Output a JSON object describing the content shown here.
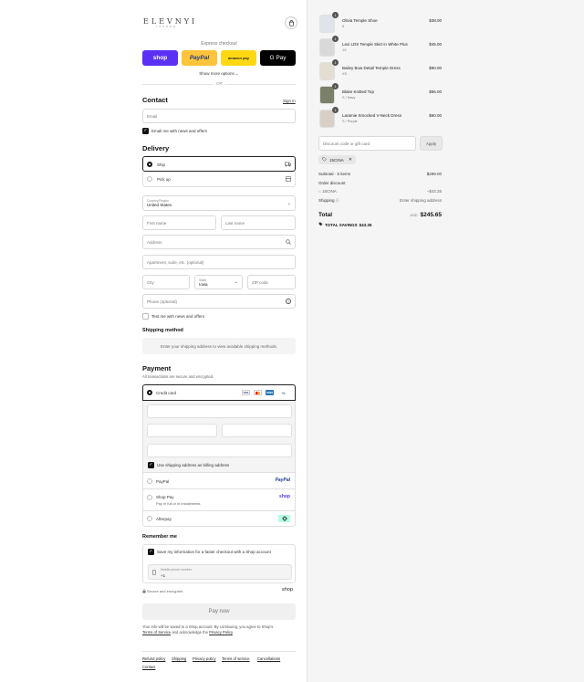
{
  "brand": {
    "logo": "ELEVNYI",
    "logo_sub": "LONDON"
  },
  "express": {
    "label": "Express checkout",
    "shop": "shop",
    "paypal": "PayPal",
    "amazon": "amazon pay",
    "gpay": "G Pay",
    "more": "Show more options ⌄",
    "or": "OR"
  },
  "contact": {
    "title": "Contact",
    "signin": "Sign in",
    "email_placeholder": "Email",
    "news_label": "Email me with news and offers"
  },
  "delivery": {
    "title": "Delivery",
    "ship": "Ship",
    "pickup": "Pick up",
    "country_label": "Country/Region",
    "country_value": "United States",
    "first_name": "First name",
    "last_name": "Last name",
    "address": "Address",
    "apartment": "Apartment, suite, etc. (optional)",
    "city": "City",
    "state_label": "State",
    "state_value": "Iowa",
    "zip": "ZIP code",
    "phone": "Phone (optional)",
    "text_label": "Text me with news and offers"
  },
  "shipping_method": {
    "title": "Shipping method",
    "note": "Enter your shipping address to view available shipping methods."
  },
  "payment": {
    "title": "Payment",
    "subtitle": "All transactions are secure and encrypted.",
    "credit_card": "Credit card",
    "card_more": "+6",
    "billing_label": "Use shipping address as billing address",
    "paypal": "PayPal",
    "paypal_logo": "PayPal",
    "shoppay": "Shop Pay",
    "shoppay_sub": "Pay in full or in installments",
    "shoppay_logo": "shop",
    "afterpay": "Afterpay"
  },
  "remember": {
    "title": "Remember me",
    "save_label": "Save my information for a faster checkout with a Shop account",
    "phone_label": "Mobile phone number",
    "phone_value": "+1",
    "secure": "Secure and encrypted",
    "shop_logo": "shop"
  },
  "paynow": "Pay now",
  "legal": {
    "line1": "Your info will be saved to a Shop account. By continuing, you agree to Shop's",
    "tos": "Terms of Service",
    "mid": " and acknowledge the ",
    "privacy": "Privacy Policy",
    "end": "."
  },
  "footer": [
    "Refund policy",
    "Shipping",
    "Privacy policy",
    "Terms of service",
    "Cancellations",
    "Contact"
  ],
  "cart": {
    "items": [
      {
        "name": "Olivia Temple Shoe",
        "variant": "5",
        "price": "$38.00",
        "qty": "1"
      },
      {
        "name": "Lexi LDS Temple Skirt in White Plus",
        "variant": "1X",
        "price": "$45.00",
        "qty": "1"
      },
      {
        "name": "Bailey Bow Detail Temple Dress",
        "variant": "XS",
        "price": "$90.00",
        "qty": "1"
      },
      {
        "name": "Blake Knitted Top",
        "variant": "S / Navy",
        "price": "$56.00",
        "qty": "1"
      },
      {
        "name": "Laramie Smocked V-Neck Dress",
        "variant": "S / Purple",
        "price": "$60.00",
        "qty": "1"
      }
    ],
    "discount_placeholder": "Discount code or gift card",
    "apply": "Apply",
    "code": "15CINA",
    "subtotal_label": "Subtotal · 5 items",
    "subtotal_value": "$289.00",
    "order_discount": "Order discount",
    "discount_code": "15CINA",
    "discount_value": "−$43.35",
    "shipping_label": "Shipping",
    "shipping_value": "Enter shipping address",
    "total_label": "Total",
    "currency": "USD",
    "total_value": "$245.65",
    "savings_label": "TOTAL SAVINGS",
    "savings_value": "$43.35"
  }
}
